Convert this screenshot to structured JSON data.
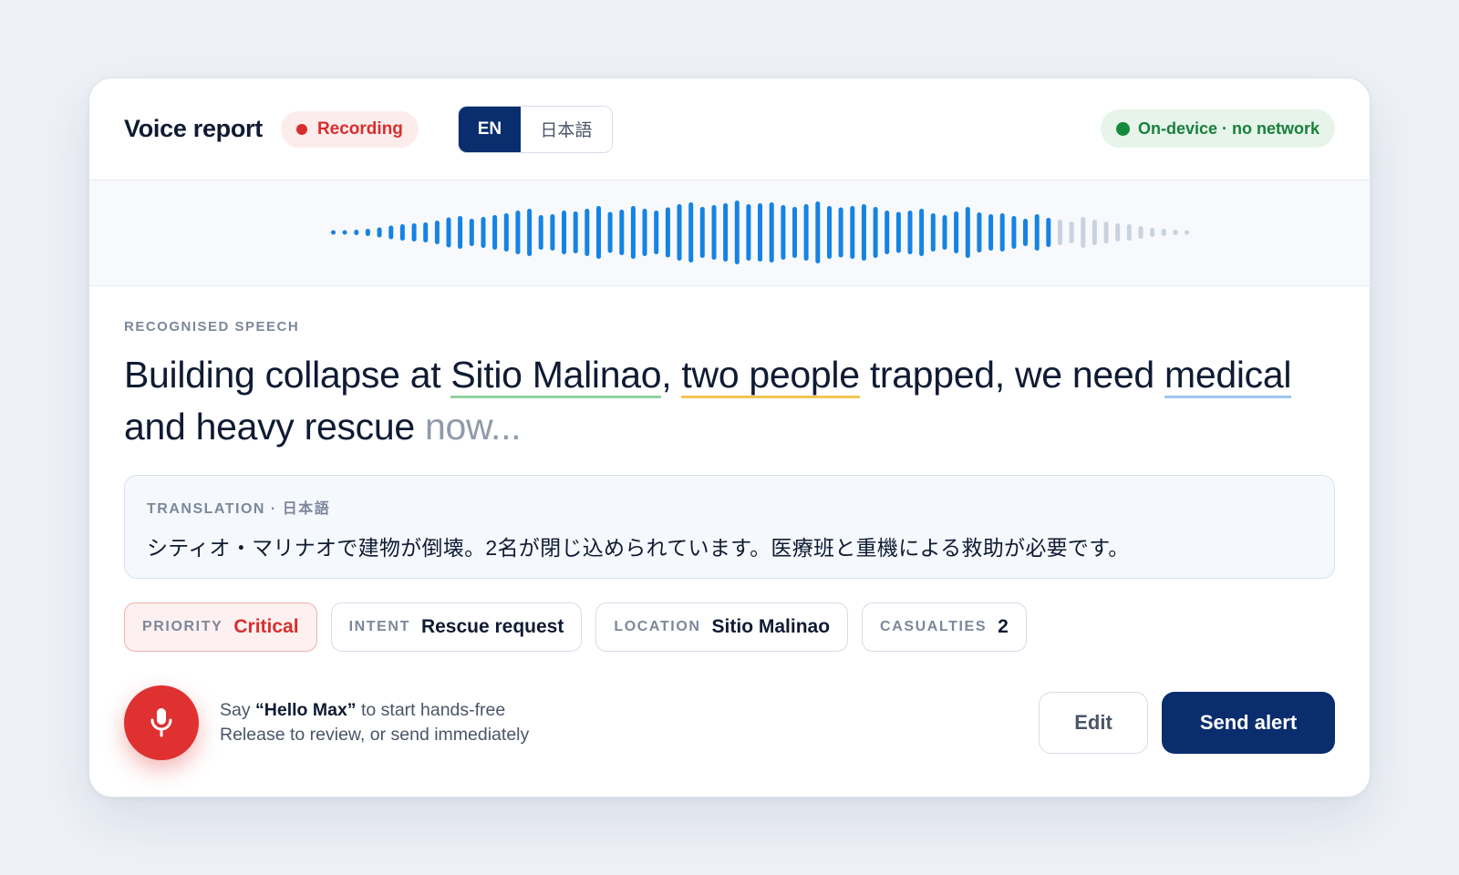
{
  "header": {
    "title": "Voice report",
    "recording_label": "Recording",
    "languages": [
      "EN",
      "日本語"
    ],
    "active_language": "EN",
    "network_status": "On-device · no network"
  },
  "waveform": {
    "active_color": "#1583e3",
    "pending_color": "#c9d3e0"
  },
  "recognised": {
    "label": "RECOGNISED SPEECH",
    "segments": {
      "s1": "Building collapse at ",
      "location": "Sitio Malinao",
      "s2": ", ",
      "people": "two people",
      "s3": " trapped, we need ",
      "medical": "medical",
      "s4": " and heavy rescue ",
      "pending": "now..."
    }
  },
  "translation": {
    "label": "TRANSLATION · 日本語",
    "text": "シティオ・マリナオで建物が倒壊。2名が閉じ込められています。医療班と重機による救助が必要です。"
  },
  "chips": [
    {
      "key": "PRIORITY",
      "value": "Critical"
    },
    {
      "key": "INTENT",
      "value": "Rescue request"
    },
    {
      "key": "LOCATION",
      "value": "Sitio Malinao"
    },
    {
      "key": "CASUALTIES",
      "value": "2"
    }
  ],
  "footer": {
    "hint_prefix": "Say ",
    "hint_wake_word": "“Hello Max”",
    "hint_suffix": " to start hands-free",
    "hint_line2": "Release to review, or send immediately",
    "edit_label": "Edit",
    "send_label": "Send alert"
  },
  "colors": {
    "accent_navy": "#0a2d6e",
    "danger_red": "#e03131",
    "success_green": "#168a3c"
  }
}
